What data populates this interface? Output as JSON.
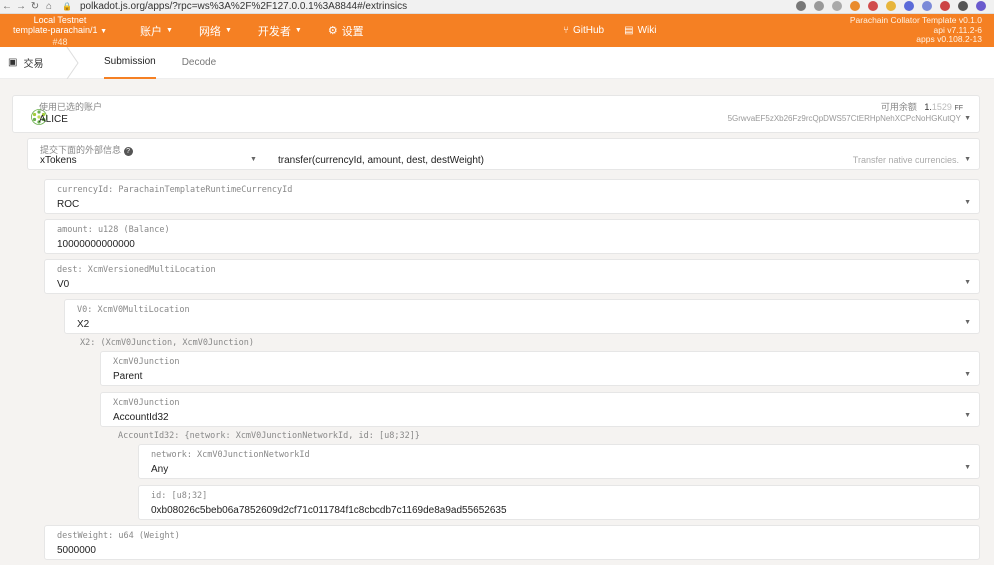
{
  "browser": {
    "url": "polkadot.js.org/apps/?rpc=ws%3A%2F%2F127.0.0.1%3A8844#/extrinsics"
  },
  "header": {
    "chain_name": "Local Testnet",
    "chain_sub": "template-parachain/1",
    "block": "#48",
    "menu": [
      {
        "label": "账户"
      },
      {
        "label": "网络"
      },
      {
        "label": "开发者"
      },
      {
        "label": "设置"
      }
    ],
    "github": "GitHub",
    "wiki": "Wiki",
    "version_title": "Parachain Collator Template v0.1.0",
    "version_api": "api v7.11.2-6",
    "version_apps": "apps v0.108.2-13"
  },
  "subtabs": {
    "section": "交易",
    "tabs": [
      "Submission",
      "Decode"
    ]
  },
  "account": {
    "label": "使用已选的账户",
    "name": "ALICE",
    "balance_label": "可用余额",
    "balance_int": "1.",
    "balance_dec": "1529",
    "balance_unit": "FF",
    "address": "5GrwvaEF5zXb26Fz9rcQpDWS57CtERHpNehXCPcNoHGKutQY"
  },
  "extrinsic": {
    "label": "提交下面的外部信息",
    "pallet": "xTokens",
    "call": "transfer(currencyId, amount, dest, destWeight)",
    "description": "Transfer native currencies."
  },
  "params": {
    "currency_label": "currencyId: ParachainTemplateRuntimeCurrencyId",
    "currency_value": "ROC",
    "amount_label": "amount: u128 (Balance)",
    "amount_value": "10000000000000",
    "dest_label": "dest: XcmVersionedMultiLocation",
    "dest_value": "V0",
    "v0_label": "V0: XcmV0MultiLocation",
    "v0_value": "X2",
    "x2_label": "X2: (XcmV0Junction, XcmV0Junction)",
    "j1_label": "XcmV0Junction",
    "j1_value": "Parent",
    "j2_label": "XcmV0Junction",
    "j2_value": "AccountId32",
    "acc32_label": "AccountId32: {network: XcmV0JunctionNetworkId, id: [u8;32]}",
    "network_label": "network: XcmV0JunctionNetworkId",
    "network_value": "Any",
    "id_label": "id: [u8;32]",
    "id_value": "0xb08026c5beb06a7852609d2cf71c011784f1c8cbcdb7c1169de8a9ad55652635",
    "weight_label": "destWeight: u64 (Weight)",
    "weight_value": "5000000"
  },
  "colors": {
    "brand": "#f58023"
  }
}
